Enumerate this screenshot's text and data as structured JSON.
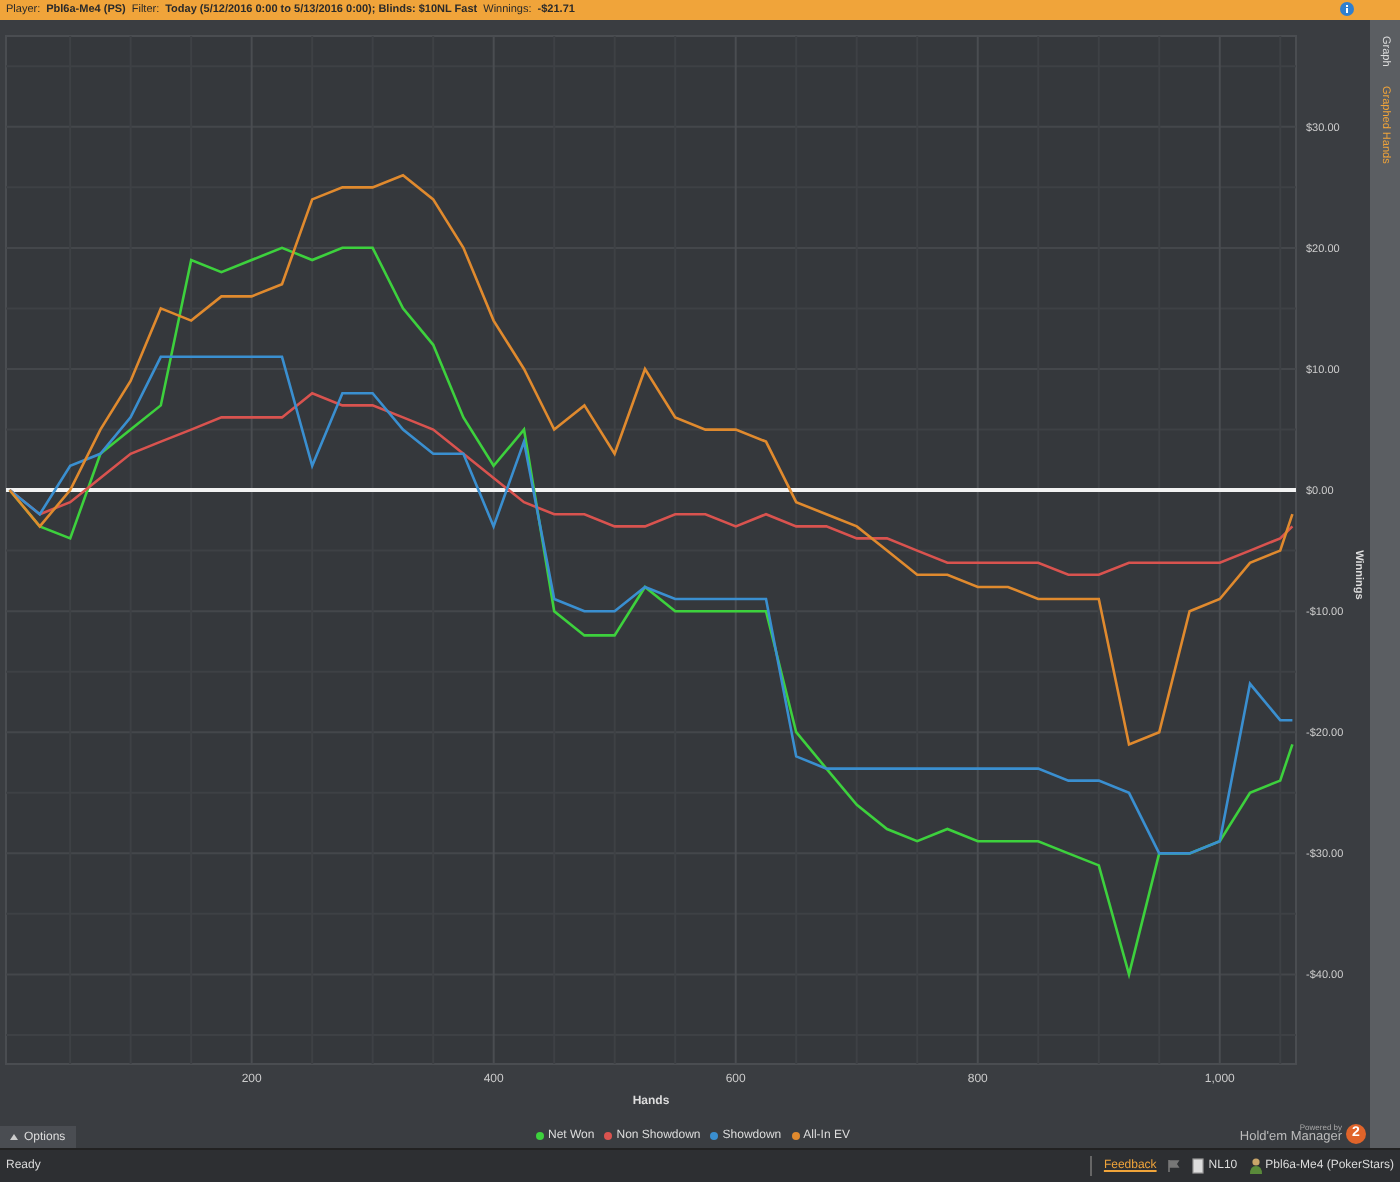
{
  "header": {
    "fields": [
      {
        "label": "Player:",
        "value": "Pbl6a-Me4 (PS)"
      },
      {
        "label": "Filter:",
        "value": "Today (5/12/2016 0:00 to 5/13/2016 0:00); Blinds: $10NL Fast"
      },
      {
        "label": "Winnings:",
        "value": "-$21.71"
      }
    ]
  },
  "side_tabs": [
    {
      "label": "Graph",
      "selected": false
    },
    {
      "label": "Graphed Hands",
      "selected": true
    }
  ],
  "chart": {
    "chart_data": {
      "type": "line",
      "xlabel": "Hands",
      "ylabel": "Winnings",
      "x": [
        0,
        25,
        50,
        75,
        100,
        125,
        150,
        175,
        200,
        225,
        250,
        275,
        300,
        325,
        350,
        375,
        400,
        425,
        450,
        475,
        500,
        525,
        550,
        575,
        600,
        625,
        650,
        675,
        700,
        725,
        750,
        775,
        800,
        825,
        850,
        875,
        900,
        925,
        950,
        975,
        1000,
        1025,
        1050,
        1060
      ],
      "series": [
        {
          "name": "Net Won",
          "color": "#3dd13d",
          "values": [
            0,
            -3,
            -4,
            3,
            5,
            7,
            19,
            18,
            19,
            20,
            19,
            20,
            20,
            15,
            12,
            6,
            2,
            5,
            -10,
            -12,
            -12,
            -8,
            -10,
            -10,
            -10,
            -10,
            -20,
            -23,
            -26,
            -28,
            -29,
            -28,
            -29,
            -29,
            -29,
            -30,
            -31,
            -40,
            -30,
            -30,
            -29,
            -25,
            -24,
            -21
          ]
        },
        {
          "name": "Non Showdown",
          "color": "#d9534f",
          "values": [
            0,
            -2,
            -1,
            1,
            3,
            4,
            5,
            6,
            6,
            6,
            8,
            7,
            7,
            6,
            5,
            3,
            1,
            -1,
            -2,
            -2,
            -3,
            -3,
            -2,
            -2,
            -3,
            -2,
            -3,
            -3,
            -4,
            -4,
            -5,
            -6,
            -6,
            -6,
            -6,
            -7,
            -7,
            -6,
            -6,
            -6,
            -6,
            -5,
            -4,
            -3
          ]
        },
        {
          "name": "Showdown",
          "color": "#3a8fd0",
          "values": [
            0,
            -2,
            2,
            3,
            6,
            11,
            11,
            11,
            11,
            11,
            2,
            8,
            8,
            5,
            3,
            3,
            -3,
            4,
            -9,
            -10,
            -10,
            -8,
            -9,
            -9,
            -9,
            -9,
            -22,
            -23,
            -23,
            -23,
            -23,
            -23,
            -23,
            -23,
            -23,
            -24,
            -24,
            -25,
            -30,
            -30,
            -29,
            -16,
            -19,
            -19
          ]
        },
        {
          "name": "All-In EV",
          "color": "#e08a2e",
          "values": [
            0,
            -3,
            0,
            5,
            9,
            15,
            14,
            16,
            16,
            17,
            24,
            25,
            25,
            26,
            24,
            20,
            14,
            10,
            5,
            7,
            3,
            10,
            6,
            5,
            5,
            4,
            -1,
            -2,
            -3,
            -5,
            -7,
            -7,
            -8,
            -8,
            -9,
            -9,
            -9,
            -21,
            -20,
            -10,
            -9,
            -6,
            -5,
            -2
          ]
        }
      ],
      "grid": true,
      "xlim": [
        -3,
        1063
      ],
      "ylim": [
        -47.4,
        37.5
      ],
      "xticks": [
        200,
        400,
        600,
        800,
        {
          "value": 1000,
          "label": "1,000"
        }
      ],
      "yticks": [
        {
          "value": 30,
          "label": "$30.00"
        },
        {
          "value": 20,
          "label": "$20.00"
        },
        {
          "value": 10,
          "label": "$10.00"
        },
        {
          "value": 0,
          "label": "$0.00"
        },
        {
          "value": -10,
          "label": "-$10.00"
        },
        {
          "value": -20,
          "label": "-$20.00"
        },
        {
          "value": -30,
          "label": "-$30.00"
        },
        {
          "value": -40,
          "label": "-$40.00"
        }
      ]
    }
  },
  "options_button": {
    "label": "Options"
  },
  "branding": {
    "powered_by": "Powered by",
    "product": "Hold'em Manager",
    "badge": "2"
  },
  "status_bar": {
    "status": "Ready",
    "feedback": "Feedback",
    "stakes": "NL10",
    "player": "Pbl6a-Me4 (PokerStars)"
  }
}
